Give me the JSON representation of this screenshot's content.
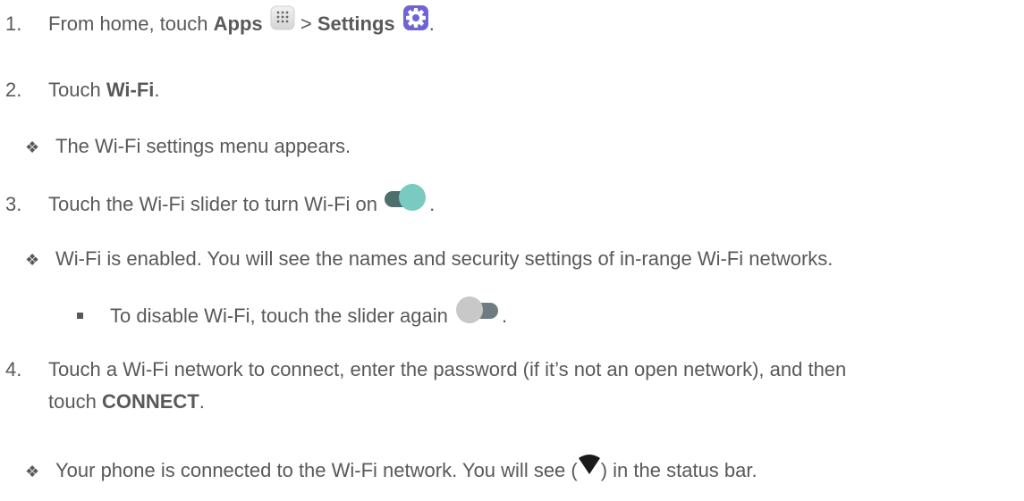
{
  "steps": [
    {
      "number": "1.",
      "text_before": "From home, touch ",
      "apps_label": "Apps",
      "separator": " > ",
      "settings_label": "Settings",
      "text_after": "."
    },
    {
      "number": "2.",
      "text_before": "Touch ",
      "bold": "Wi-Fi",
      "text_after": ".",
      "result": "The Wi-Fi settings menu appears."
    },
    {
      "number": "3.",
      "text_before": "Touch the Wi-Fi slider to turn Wi-Fi on",
      "text_after": ".",
      "result": "Wi-Fi is enabled. You will see the names and security settings of in-range Wi-Fi networks.",
      "sub_bullet": "To disable Wi-Fi, touch the slider again",
      "sub_after": "."
    },
    {
      "number": "4.",
      "line1": "Touch a Wi-Fi network to connect, enter the password (if it’s not an open network), and then",
      "line2_before": "touch ",
      "bold": "CONNECT",
      "line2_after": ".",
      "result_before": "Your phone is connected to the Wi-Fi network. You will see (",
      "result_after": ") in the status bar."
    }
  ],
  "bullets": {
    "result_glyph": "❖"
  },
  "colors": {
    "text": "#595959",
    "toggle_on_track": "#4f6f6e",
    "toggle_on_knob": "#79cbc1",
    "toggle_off_track": "#6e7c82",
    "toggle_off_knob": "#c8c8c8",
    "settings_icon": "#6f63d9",
    "wifi_icon": "#1a1a1a"
  },
  "icons": [
    "apps-icon",
    "settings-gear-icon",
    "toggle-on-icon",
    "toggle-off-icon",
    "wifi-signal-icon"
  ]
}
